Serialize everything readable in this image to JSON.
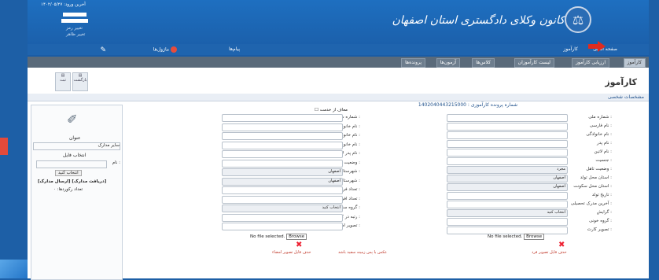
{
  "header": {
    "title": "کانون وکلای دادگستری استان اصفهان",
    "user_lines": [
      "آخرین ورود: ۱۴۰۲/۰۵/۲۷",
      "تغییر رمز",
      "تغییر ظاهر"
    ],
    "nav": [
      "صفحه اصلی",
      "کارآموز",
      "پیام‌ها",
      "ماژول‌ها"
    ],
    "badge_count": "۰"
  },
  "tabs": [
    "کارآموز",
    "ارزیابی کارآموز",
    "لیست کارآموزان",
    "کلاس‌ها",
    "آزمون‌ها",
    "پرونده‌ها"
  ],
  "page": {
    "title": "کارآموز",
    "section": "مشخصات شخصی",
    "id_line": "شماره پرونده کارآموزی : 1402040443215000"
  },
  "toolbar": [
    "ثبت",
    "بازگشت"
  ],
  "form_right": [
    {
      "label": "شماره ملی :",
      "value": ""
    },
    {
      "label": "نام فارسی :",
      "value": ""
    },
    {
      "label": "نام خانوادگی :",
      "value": ""
    },
    {
      "label": "نام پدر :",
      "value": ""
    },
    {
      "label": "نام لاتین :",
      "value": ""
    },
    {
      "label": "جنسیت :",
      "value": ""
    },
    {
      "label": "وضعیت تاهل :",
      "value": "مجرد"
    },
    {
      "label": "استان محل تولد :",
      "value": "اصفهان"
    },
    {
      "label": "استان محل سکونت :",
      "value": "اصفهان"
    },
    {
      "label": "تاریخ تولد :",
      "value": ""
    },
    {
      "label": "آخرین مدرک تحصیلی :",
      "value": ""
    },
    {
      "label": "گرایش :",
      "value": "انتخاب کنید"
    },
    {
      "label": "گروه خونی :",
      "value": ""
    },
    {
      "label": "تصویر کارت :",
      "value": ""
    }
  ],
  "form_mid": [
    {
      "label": "شماره شناسنامه :",
      "value": ""
    },
    {
      "label": "نام خانوادگی فارسی :",
      "value": ""
    },
    {
      "label": "نام خانوادگی قبلی :",
      "value": ""
    },
    {
      "label": "نام خانوادگی لاتین :",
      "value": ""
    },
    {
      "label": "نام پدر لاتین :",
      "value": ""
    },
    {
      "label": "وضعیت نظام وظیفه :",
      "value": ""
    },
    {
      "label": "شهرستان محل تولد :",
      "value": "اصفهان"
    },
    {
      "label": "شهرستان محل سکونت :",
      "value": "اصفهان"
    },
    {
      "label": "تعداد فرزند :",
      "value": ""
    },
    {
      "label": "تعداد افراد تحت تکفل :",
      "value": ""
    },
    {
      "label": "گروه سنی :",
      "value": "انتخاب کنید"
    },
    {
      "label": "رتبه در کنکور :",
      "value": ""
    },
    {
      "label": "تصویر امضاء :",
      "value": ""
    }
  ],
  "checkbox_label": "معاف از خدمت",
  "file": {
    "browse": "Browse",
    "none": "No file selected."
  },
  "delete_photo": "حذف فایل تصویر فرد",
  "delete_sign": "حذف فایل تصویر امضاء",
  "note": "عکس با پس زمینه سفید باشد",
  "sidebar": {
    "title": "عنوان",
    "select_value": "سایر مدارک",
    "file_label": "انتخاب فایل",
    "name_label": "نام :",
    "upload_btn": "انتخاب کنید",
    "links": "[ارسال مدارک] [دریافت مدارک]",
    "footer": "تعداد رکوردها: ۰"
  },
  "colors": {
    "header": "#1d5fa6",
    "accent": "#e24a3b",
    "tabs": "#5a6a7a"
  }
}
